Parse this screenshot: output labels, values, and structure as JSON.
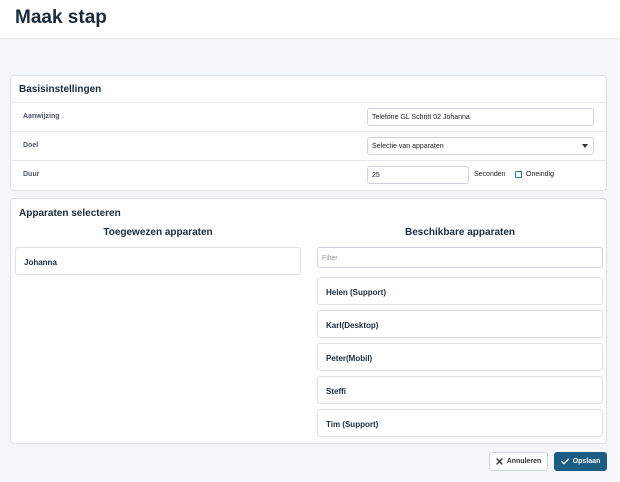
{
  "header": {
    "title": "Maak stap"
  },
  "basis": {
    "title": "Basisinstellingen",
    "rows": {
      "aanwijzing": {
        "label": "Aanwijzing",
        "value": "Telefone GL Schritt 02 Johanna"
      },
      "doel": {
        "label": "Doel",
        "selected": "Selectie van apparaten"
      },
      "duur": {
        "label": "Duur",
        "value": "25",
        "unit_label": "Seconden",
        "checkbox_label": "Oneindig",
        "checkbox_checked": false
      }
    }
  },
  "devices": {
    "title": "Apparaten selecteren",
    "assigned_heading": "Toegewezen apparaten",
    "available_heading": "Beschikbare apparaten",
    "filter_placeholder": "Filter",
    "assigned": [
      "Johanna"
    ],
    "available": [
      "Helen (Support)",
      "Karl(Desktop)",
      "Peter(Mobil)",
      "Steffi",
      "Tim (Support)"
    ]
  },
  "footer": {
    "cancel_label": "Annuleren",
    "save_label": "Opslaan"
  },
  "colors": {
    "primary": "#1c5d86",
    "checkbox": "#2a7ab0"
  }
}
